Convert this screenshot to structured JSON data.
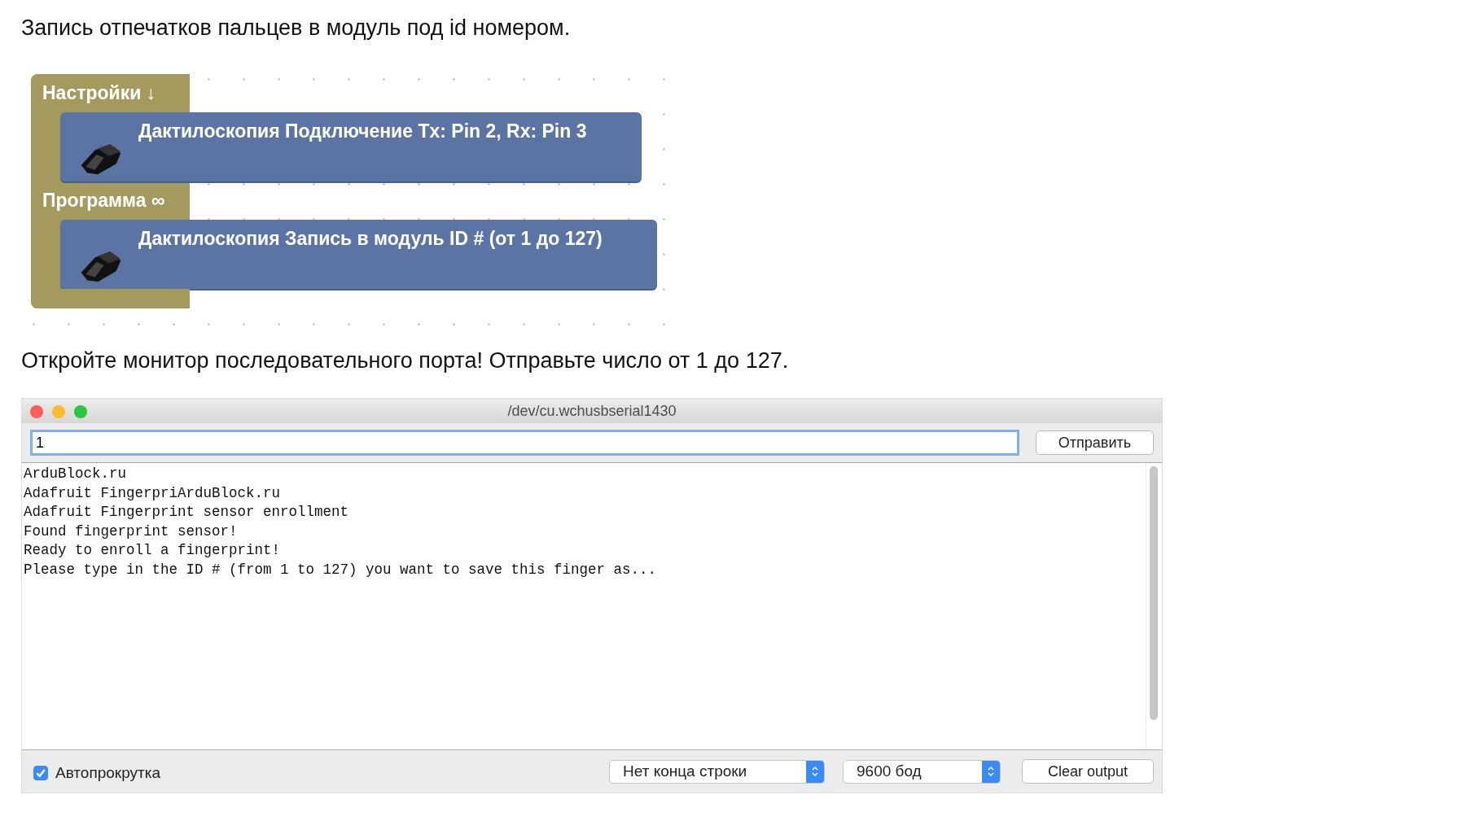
{
  "heading": "Запись отпечатков пальцев в модуль под id номером.",
  "blocks": [
    {
      "label": "Настройки ↓",
      "text": "Дактилоскопия Подключение Tx: Pin 2, Rx: Pin 3"
    },
    {
      "label": "Программа ∞",
      "text": "Дактилоскопия Запись в модуль ID # (от 1 до 127)"
    }
  ],
  "instruction": "Откройте монитор последовательного порта! Отправьте число от 1 до 127.",
  "serial_monitor": {
    "title": "/dev/cu.wchusbserial1430",
    "input": {
      "value": "1"
    },
    "send_button": "Отправить",
    "output_lines": [
      "ArduBlock.ru",
      "Adafruit FingerpriArduBlock.ru",
      "Adafruit Fingerprint sensor enrollment",
      "Found fingerprint sensor!",
      "Ready to enroll a fingerprint!",
      "Please type in the ID # (from 1 to 127) you want to save this finger as..."
    ],
    "autoscroll": {
      "label": "Автопрокрутка",
      "checked": true
    },
    "line_ending": "Нет конца строки",
    "baud_rate": "9600 бод",
    "clear_button": "Clear output"
  }
}
